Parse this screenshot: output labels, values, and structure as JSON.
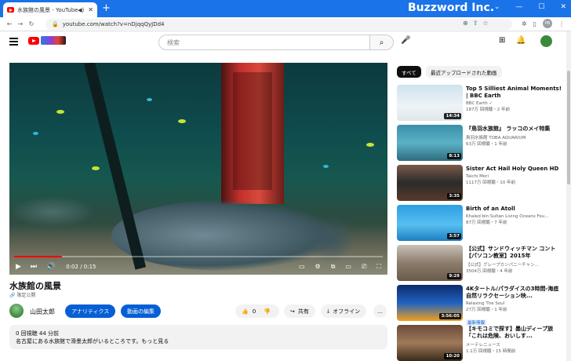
{
  "browser": {
    "tab_title": "水族館の風景 - YouTube",
    "tab_audio": "◀)",
    "tab_close": "✕",
    "new_tab": "+",
    "brand": "Buzzword Inc.",
    "url": "youtube.com/watch?v=nDjqqQyJDd4",
    "profile": "PB"
  },
  "header": {
    "search_placeholder": "検索"
  },
  "player": {
    "time": "0:02 / 0:15",
    "progress_fraction": 0.13
  },
  "video": {
    "title": "水族館の風景",
    "visibility": "限定公開",
    "channel": "山田太郎",
    "analytics_label": "アナリティクス",
    "edit_label": "動画の編集",
    "like_count": "0",
    "share_label": "共有",
    "offline_label": "オフライン",
    "more_label": "…",
    "stats": "0 回視聴  44 分前",
    "description": "名古屋にある水族館で滑墨太郎がいるところです。もっと見る"
  },
  "chips": {
    "all": "すべて",
    "recent": "最近アップロードされた動画"
  },
  "recommendations": [
    {
      "title": "Top 5 Silliest Animal Moments! | BBC Earth",
      "channel": "BBC Earth ✓",
      "meta": "187万 回視聴・2 年前",
      "duration": "14:34",
      "badge": ""
    },
    {
      "title": "『鳥羽水族館』 ラッコのメイ特集",
      "channel": "鳥羽水族館 TOBA AQUARIUM",
      "meta": "63万 回視聴・1 年前",
      "duration": "8:13",
      "badge": ""
    },
    {
      "title": "Sister Act Hail Holy Queen HD",
      "channel": "Taichi Mori",
      "meta": "1117万 回視聴・10 年前",
      "duration": "3:35",
      "badge": ""
    },
    {
      "title": "Birth of an Atoll",
      "channel": "Khaled bin Sultan Living Oceans Fou...",
      "meta": "87万 回視聴・7 年前",
      "duration": "3:57",
      "badge": ""
    },
    {
      "title": "【公式】サンドウィッチマン コント【パソコン教室】2015年",
      "channel": "【公式】グレープカンパニーチャン...",
      "meta": "3504万 回視聴・4 年前",
      "duration": "9:29",
      "badge": ""
    },
    {
      "title": "4Kタートル/パラダイスの3時間-海底自然リラクセーション映...",
      "channel": "Relaxing The Soul",
      "meta": "27万 回視聴・1 年前",
      "duration": "3:56:05",
      "badge": "最新情報"
    },
    {
      "title": "【キモコミで探す】墨山ディープ旅「これは危険、おいしす...",
      "channel": "メーテレニュース",
      "meta": "1.1万 回視聴・15 時間前",
      "duration": "10:20",
      "badge": ""
    }
  ]
}
